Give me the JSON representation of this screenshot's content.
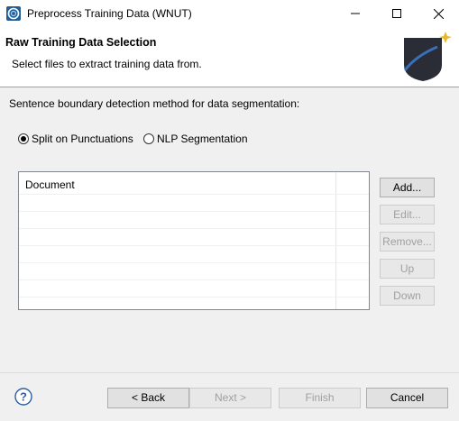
{
  "window": {
    "title": "Preprocess Training Data (WNUT)"
  },
  "banner": {
    "title": "Raw Training Data Selection",
    "description": "Select files to extract training data from."
  },
  "segmentation": {
    "question": "Sentence boundary detection method for data segmentation:",
    "options": [
      {
        "label": "Split on Punctuations",
        "selected": true
      },
      {
        "label": "NLP Segmentation",
        "selected": false
      }
    ]
  },
  "table": {
    "columns": [
      "Document"
    ]
  },
  "side_buttons": {
    "add": "Add...",
    "edit": "Edit...",
    "remove": "Remove...",
    "up": "Up",
    "down": "Down"
  },
  "footer": {
    "back": "< Back",
    "next": "Next >",
    "finish": "Finish",
    "cancel": "Cancel"
  },
  "icons": {
    "app": "app-icon",
    "minimize": "minimize-icon",
    "maximize": "maximize-icon",
    "close": "close-icon",
    "banner": "wizard-banner-icon",
    "help": "help-icon"
  }
}
